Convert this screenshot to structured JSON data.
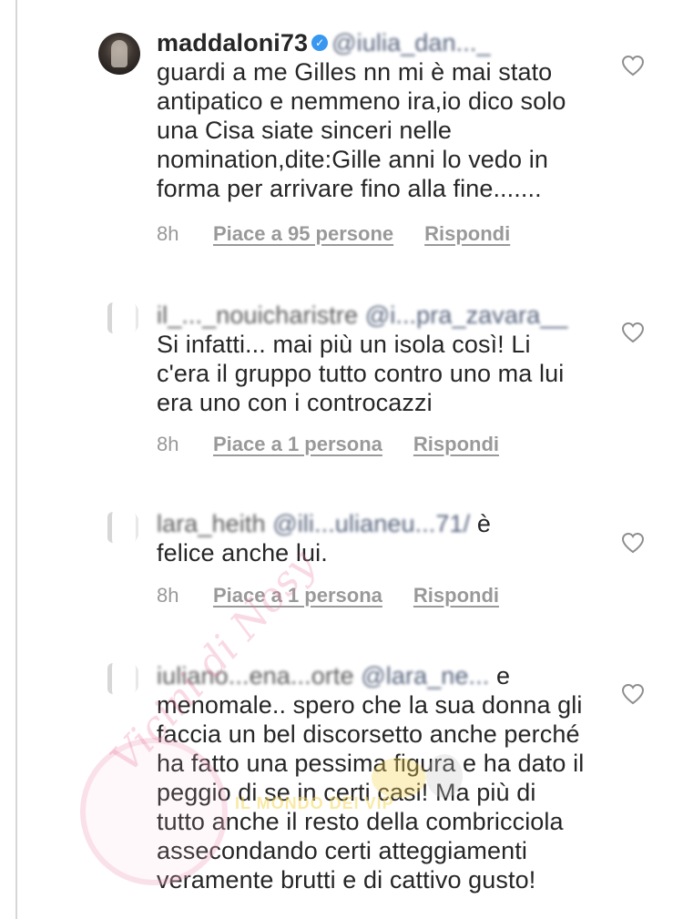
{
  "comments": [
    {
      "username": "maddaloni73",
      "verified": true,
      "mention": "@iulia_dan..._",
      "text": "guardi a me Gilles nn mi è mai stato antipatico e nemmeno ira,io dico solo una Cisa siate sinceri nelle nomination,dite:Gille anni lo vedo in forma per arrivare fino alla fine.......",
      "time": "8h",
      "likes": "Piace a 95 persone",
      "reply": "Rispondi"
    },
    {
      "username": "il_..._nouicharistre",
      "mention": "@i...pra_zavara__",
      "text": "Si infatti... mai più un isola così! Li c'era il gruppo tutto contro uno ma lui era uno con i controcazzi",
      "time": "8h",
      "likes": "Piace a 1 persona",
      "reply": "Rispondi"
    },
    {
      "username": "lara_heith",
      "mention": "@ili...ulianeu...71/",
      "text_tail": "è",
      "text": "felice anche lui.",
      "time": "8h",
      "likes": "Piace a 1 persona",
      "reply": "Rispondi"
    },
    {
      "username": "iuliano...ena...orte",
      "mention": "@lara_ne...",
      "text_tail": "e",
      "text": "menomale.. spero che la sua donna gli faccia un bel discorsetto anche perché ha fatto una pessima figura e ha dato il peggio di se in certi casi! Ma più di tutto anche il resto della combricciola assecondando certi atteggiamenti veramente brutti e di cattivo gusto!"
    }
  ],
  "watermark": {
    "script_text": "Vicini di Nosy",
    "tagline": "IL MONDO DEI VIP"
  },
  "icons": {
    "like": "heart-outline-icon",
    "verified": "verified-badge-icon"
  },
  "colors": {
    "text": "#262626",
    "meta": "#999999",
    "verified": "#3897f0",
    "thread_line": "#d6d6d6"
  }
}
